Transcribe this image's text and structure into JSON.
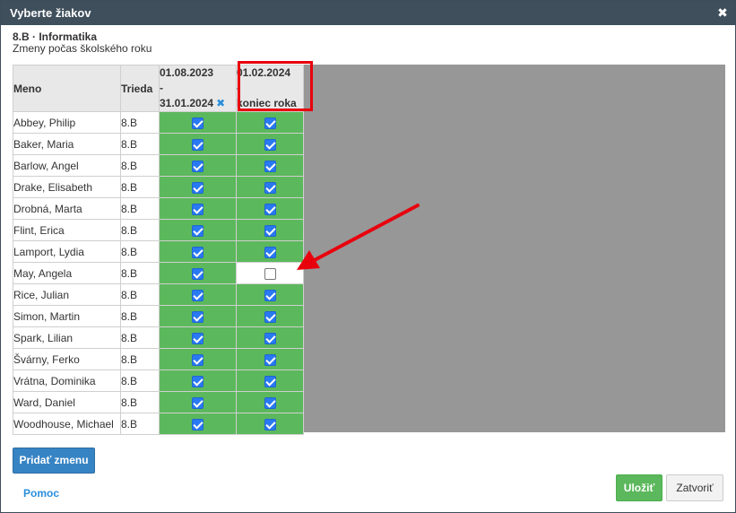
{
  "dialog": {
    "title": "Vyberte žiakov",
    "close_glyph": "✖"
  },
  "header": {
    "subject": "8.B · Informatika",
    "subtitle": "Zmeny počas školského roku"
  },
  "table": {
    "col_name": "Meno",
    "col_class": "Trieda",
    "periods": [
      {
        "line1": "01.08.2023",
        "line2": "-",
        "line3": "31.01.2024",
        "remove_icon": "✖"
      },
      {
        "line1": "01.02.2024",
        "line2": "-",
        "line3": "koniec roka"
      }
    ],
    "rows": [
      {
        "name": "Abbey, Philip",
        "class": "8.B",
        "p1": true,
        "p2": true
      },
      {
        "name": "Baker, Maria",
        "class": "8.B",
        "p1": true,
        "p2": true
      },
      {
        "name": "Barlow, Angel",
        "class": "8.B",
        "p1": true,
        "p2": true
      },
      {
        "name": "Drake, Elisabeth",
        "class": "8.B",
        "p1": true,
        "p2": true
      },
      {
        "name": "Drobná, Marta",
        "class": "8.B",
        "p1": true,
        "p2": true
      },
      {
        "name": "Flint, Erica",
        "class": "8.B",
        "p1": true,
        "p2": true
      },
      {
        "name": "Lamport, Lydia",
        "class": "8.B",
        "p1": true,
        "p2": true
      },
      {
        "name": "May, Angela",
        "class": "8.B",
        "p1": true,
        "p2": false
      },
      {
        "name": "Rice, Julian",
        "class": "8.B",
        "p1": true,
        "p2": true
      },
      {
        "name": "Simon, Martin",
        "class": "8.B",
        "p1": true,
        "p2": true
      },
      {
        "name": "Spark, Lilian",
        "class": "8.B",
        "p1": true,
        "p2": true
      },
      {
        "name": "Švárny, Ferko",
        "class": "8.B",
        "p1": true,
        "p2": true
      },
      {
        "name": "Vrátna, Dominika",
        "class": "8.B",
        "p1": true,
        "p2": true
      },
      {
        "name": "Ward, Daniel",
        "class": "8.B",
        "p1": true,
        "p2": true
      },
      {
        "name": "Woodhouse, Michael",
        "class": "8.B",
        "p1": true,
        "p2": true
      }
    ]
  },
  "buttons": {
    "add_change": "Pridať zmenu",
    "help": "Pomoc",
    "save": "Uložiť",
    "close": "Zatvoriť"
  },
  "colors": {
    "titlebar": "#3f4f5c",
    "checked_cell": "#5cb85c",
    "highlight": "#e8000d",
    "primary": "#3784c4"
  }
}
